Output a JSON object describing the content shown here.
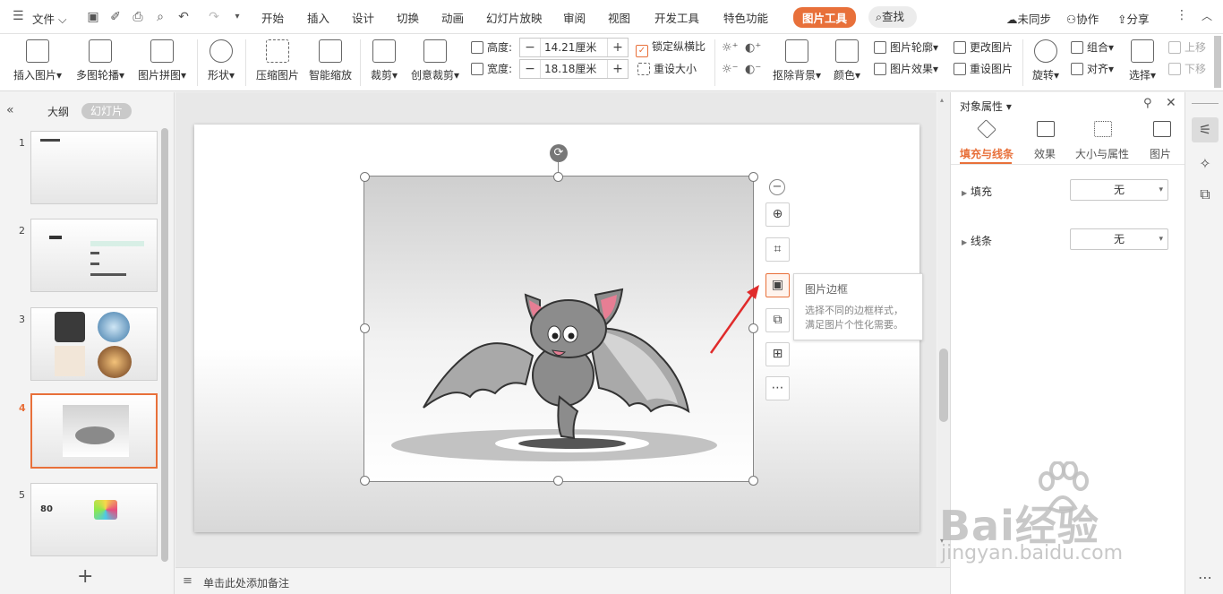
{
  "menubar": {
    "file": "文件",
    "tabs": [
      "开始",
      "插入",
      "设计",
      "切换",
      "动画",
      "幻灯片放映",
      "审阅",
      "视图",
      "开发工具",
      "特色功能",
      "图片工具"
    ],
    "search": "查找",
    "sync": "未同步",
    "collab": "协作",
    "share": "分享"
  },
  "ribbon": {
    "insert_picture": "插入图片",
    "multi_outline": "多图轮播",
    "collage": "图片拼图",
    "shape": "形状",
    "compress": "压缩图片",
    "smart_zoom": "智能缩放",
    "crop": "裁剪",
    "creative_crop": "创意裁剪",
    "height_label": "高度:",
    "height_value": "14.21厘米",
    "width_label": "宽度:",
    "width_value": "18.18厘米",
    "lock_ratio": "锁定纵横比",
    "reset_size": "重设大小",
    "remove_bg": "抠除背景",
    "color": "颜色",
    "pic_outline": "图片轮廓",
    "pic_effect": "图片效果",
    "change_pic": "更改图片",
    "reset_pic": "重设图片",
    "rotate": "旋转",
    "group": "组合",
    "align": "对齐",
    "select": "选择",
    "bring_up": "上移",
    "send_down": "下移"
  },
  "leftpanel": {
    "outline_tab": "大纲",
    "slides_tab": "幻灯片",
    "slide_numbers": [
      "1",
      "2",
      "3",
      "4",
      "5"
    ],
    "slide5_text": "80"
  },
  "tooltip": {
    "title": "图片边框",
    "desc": "选择不同的边框样式，满足图片个性化需要。"
  },
  "notes": {
    "placeholder": "单击此处添加备注"
  },
  "rightpanel": {
    "title": "对象属性",
    "tabs": [
      "填充与线条",
      "效果",
      "大小与属性",
      "图片"
    ],
    "fill_label": "填充",
    "fill_value": "无",
    "line_label": "线条",
    "line_value": "无"
  },
  "watermark": {
    "brand": "Bai经验",
    "url": "jingyan.baidu.com"
  },
  "colors": {
    "accent": "#e8703a"
  }
}
